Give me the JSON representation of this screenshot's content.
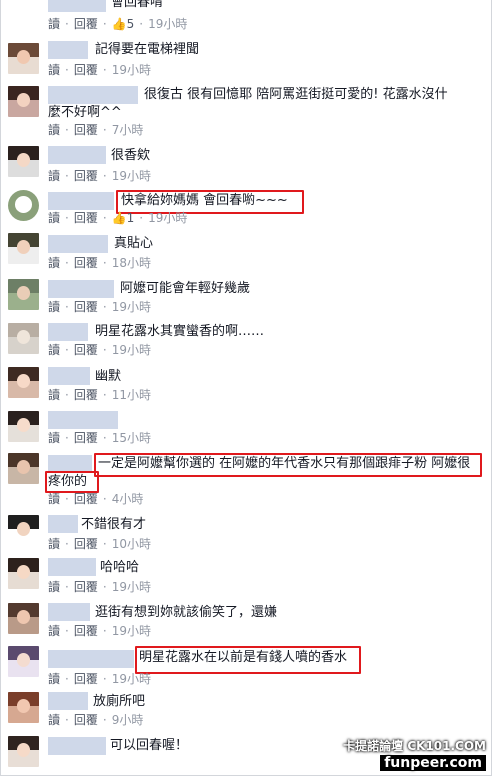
{
  "actions": {
    "read": "讀",
    "reply": "回覆"
  },
  "watermark": {
    "line1": "卡提諾論壇 CK101.COM",
    "line2": "funpeer.com"
  },
  "comments": [
    {
      "text": "會回春唷",
      "time": "19小時",
      "likes": "5"
    },
    {
      "text": "記得要在電梯裡聞",
      "time": "19小時"
    },
    {
      "text": "很復古 很有回憶耶 陪阿罵逛街挺可愛的! 花露水沒什麼不好啊^^",
      "time": "7小時"
    },
    {
      "text": "很香欸",
      "time": "19小時"
    },
    {
      "text": "快拿給妳媽媽 會回春喲~~~",
      "time": "19小時",
      "likes": "1"
    },
    {
      "text": "真貼心",
      "time": "18小時"
    },
    {
      "text": "阿嬤可能會年輕好幾歲",
      "time": "19小時"
    },
    {
      "text": "明星花露水其實蠻香的啊……",
      "time": "19小時"
    },
    {
      "text": "幽默",
      "time": "11小時"
    },
    {
      "text": "",
      "time": "15小時"
    },
    {
      "text": "一定是阿嬤幫你選的 在阿嬤的年代香水只有那個跟痱子粉 阿嬤很疼你的",
      "time": "4小時"
    },
    {
      "text": "不錯很有才",
      "time": "10小時"
    },
    {
      "text": "哈哈哈",
      "time": "19小時"
    },
    {
      "text": "逛街有想到妳就該偷笑了，還嫌",
      "time": "19小時"
    },
    {
      "text": "明星花露水在以前是有錢人噴的香水",
      "time": "19小時"
    },
    {
      "text": "放廁所吧",
      "time": "9小時"
    },
    {
      "text": "可以回春喔！",
      "time": ""
    }
  ]
}
